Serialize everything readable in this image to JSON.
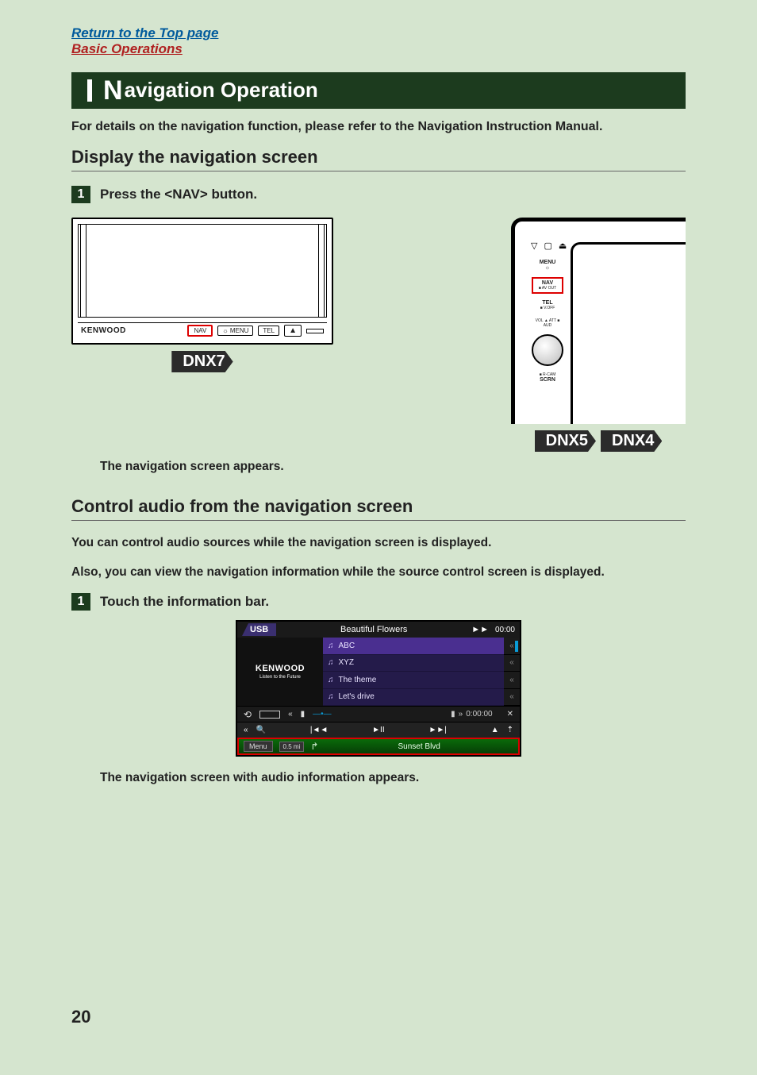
{
  "links": {
    "top": "Return to the Top page",
    "section": "Basic Operations"
  },
  "title": {
    "big": "N",
    "rest": "avigation Operation"
  },
  "intro": "For details on the navigation function, please refer to the Navigation Instruction Manual.",
  "sub1": "Display the navigation screen",
  "step1": {
    "num": "1",
    "text": "Press the <NAV> button."
  },
  "dnx7": {
    "brand": "KENWOOD",
    "buttons": {
      "nav": "NAV",
      "menu": "MENU",
      "tel": "TEL",
      "eject": "▲"
    },
    "tag": "DNX7"
  },
  "dnx54": {
    "top_icons": {
      "down": "▽",
      "stop": "▢",
      "eject": "⏏"
    },
    "labels": {
      "menu": "MENU",
      "menu_sub": "☼",
      "nav": "NAV",
      "nav_sub": "■ AV OUT",
      "tel": "TEL",
      "tel_sub": "■ V.OFF",
      "att": "VOL ▲ ATT\n■ AUD",
      "rcam": "■ R-CAM",
      "scrn": "SCRN"
    },
    "tags": [
      "DNX5",
      "DNX4"
    ]
  },
  "after_diagram": "The navigation screen appears.",
  "sub2": "Control audio from the navigation screen",
  "body2a": "You can control audio sources while the navigation screen is displayed.",
  "body2b": "Also, you can view the navigation information while the source control screen is displayed.",
  "step2": {
    "num": "1",
    "text": "Touch the information bar."
  },
  "usb": {
    "source_tab": "USB",
    "title": "Beautiful Flowers",
    "ff_icon": "►►",
    "top_time": "00:00",
    "brand": "KENWOOD",
    "slogan": "Listen to the Future",
    "tracks": [
      "ABC",
      "XYZ",
      "The theme",
      "Let's drive"
    ],
    "side_arrow": "«",
    "ctrl1": {
      "loop": "⟲",
      "rew": "«",
      "pg": "▮",
      "seek_arrow": "»",
      "playtime": "0:00:00",
      "shuffle": "✕"
    },
    "ctrl2": {
      "back": "«",
      "search": "🔍",
      "prev": "|◄◄",
      "playpause": "►II",
      "next": "►►|",
      "eject": "▲",
      "up": "⇡"
    },
    "navbar": {
      "menu": "Menu",
      "dist": "0.5 mi",
      "turn": "↱",
      "street": "Sunset Blvd"
    }
  },
  "after_usb": "The navigation screen with audio information appears.",
  "page_number": "20"
}
